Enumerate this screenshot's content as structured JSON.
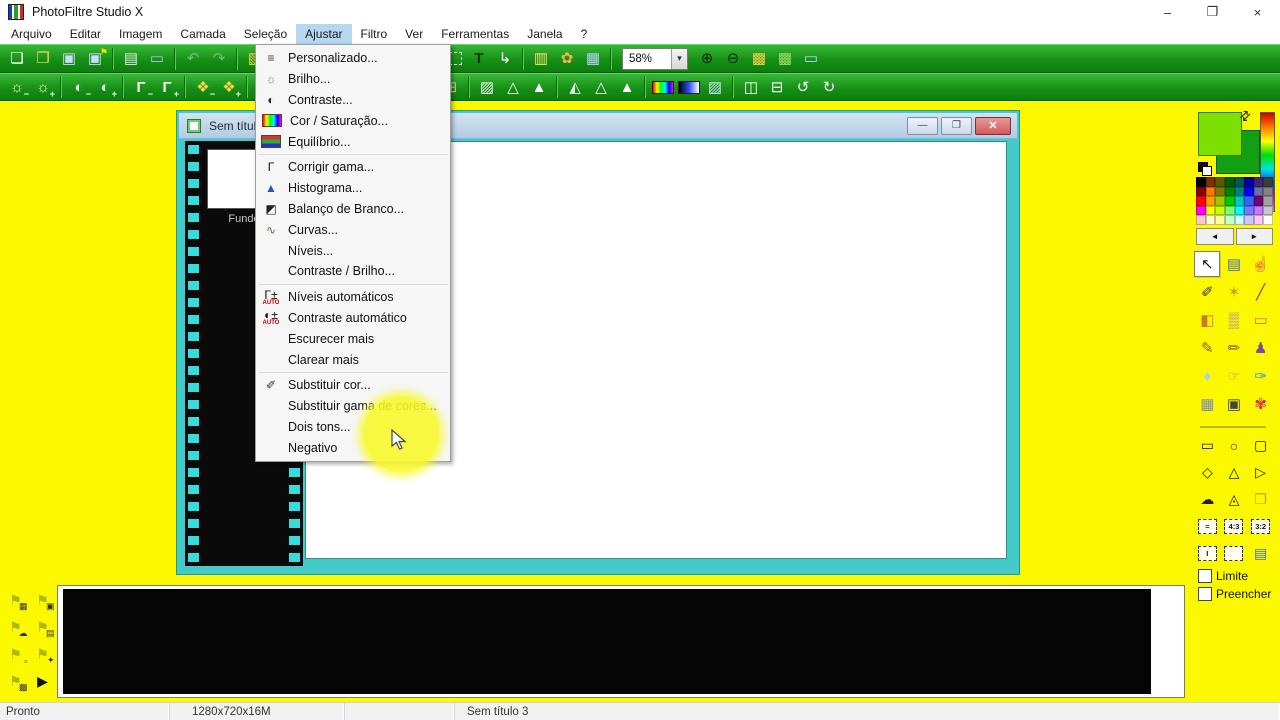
{
  "window": {
    "title": "PhotoFiltre Studio X",
    "controls": [
      {
        "id": "minimize",
        "glyph": "–"
      },
      {
        "id": "restore",
        "glyph": "❐"
      },
      {
        "id": "close",
        "glyph": "×"
      }
    ]
  },
  "menubar": {
    "items": [
      {
        "id": "arquivo",
        "label": "Arquivo"
      },
      {
        "id": "editar",
        "label": "Editar"
      },
      {
        "id": "imagem",
        "label": "Imagem"
      },
      {
        "id": "camada",
        "label": "Camada"
      },
      {
        "id": "selecao",
        "label": "Seleção"
      },
      {
        "id": "ajustar",
        "label": "Ajustar",
        "active": true
      },
      {
        "id": "filtro",
        "label": "Filtro"
      },
      {
        "id": "ver",
        "label": "Ver"
      },
      {
        "id": "ferramentas",
        "label": "Ferramentas"
      },
      {
        "id": "janela",
        "label": "Janela"
      },
      {
        "id": "ajuda",
        "label": "?"
      }
    ]
  },
  "toolbar_top": {
    "zoom_value": "58%",
    "left": [
      {
        "name": "new-file",
        "glyph": "❏",
        "color": "#ffffff"
      },
      {
        "name": "open-folder",
        "glyph": "❒",
        "color": "#f7d84a"
      },
      {
        "name": "save",
        "glyph": "▣",
        "color": "#cfd8ff"
      },
      {
        "name": "save-as",
        "glyph": "▣",
        "color": "#cfd8ff",
        "badge": "⚑",
        "badge_color": "#ffe000"
      },
      {
        "sep": true
      },
      {
        "name": "print",
        "glyph": "▤",
        "color": "#e8e8e8"
      },
      {
        "name": "scan",
        "glyph": "▭",
        "color": "#9fc4ff"
      },
      {
        "sep": true
      },
      {
        "name": "undo",
        "glyph": "↶",
        "color": "#d8f0d8",
        "grayed": true
      },
      {
        "name": "redo",
        "glyph": "↷",
        "color": "#d8f0d8",
        "grayed": true
      },
      {
        "sep": true
      },
      {
        "name": "adjust-image",
        "glyph": "▧",
        "color": "#ffd24a"
      }
    ],
    "right": [
      {
        "name": "selection-mode",
        "type": "dashed-box"
      },
      {
        "name": "text-tool",
        "glyph": "T",
        "color": "#0d330d",
        "bold": true
      },
      {
        "name": "transform",
        "glyph": "↳",
        "color": "#ffffff"
      },
      {
        "sep": true
      },
      {
        "name": "image-explorer",
        "glyph": "▥",
        "color": "#ffe36a"
      },
      {
        "name": "photomasque",
        "glyph": "✿",
        "color": "#ffb347"
      },
      {
        "name": "automate",
        "glyph": "▦",
        "color": "#bcd4ff"
      },
      {
        "sep": true
      },
      {
        "type": "zoom-combo"
      },
      {
        "name": "zoom-in",
        "glyph": "⊕",
        "color": "#0d2a0d"
      },
      {
        "name": "zoom-out",
        "glyph": "⊖",
        "color": "#0d2a0d"
      },
      {
        "name": "zoom-fit",
        "glyph": "▩",
        "color": "#ffd24a"
      },
      {
        "name": "zoom-full",
        "glyph": "▩",
        "color": "#9fe06a"
      },
      {
        "name": "full-screen",
        "glyph": "▭",
        "color": "#bcd4ff"
      }
    ]
  },
  "toolbar_filters": {
    "left": [
      {
        "name": "brightness-minus",
        "glyph": "☼",
        "sub": "−",
        "color": "#fff4b0"
      },
      {
        "name": "brightness-plus",
        "glyph": "☼",
        "sub": "+",
        "color": "#fff4b0"
      },
      {
        "sep": true
      },
      {
        "name": "contrast-minus",
        "glyph": "◐",
        "sub": "−",
        "color": "#f0f0f0"
      },
      {
        "name": "contrast-plus",
        "glyph": "◐",
        "sub": "+",
        "color": "#f0f0f0"
      },
      {
        "sep": true
      },
      {
        "name": "gamma-minus",
        "glyph": "Γ",
        "sub": "−",
        "color": "#ffffff",
        "bold": true
      },
      {
        "name": "gamma-plus",
        "glyph": "Γ",
        "sub": "+",
        "color": "#ffffff",
        "bold": true
      },
      {
        "sep": true
      },
      {
        "name": "saturation-minus",
        "glyph": "❖",
        "sub": "−",
        "color": "#ffd24a"
      },
      {
        "name": "saturation-plus",
        "glyph": "❖",
        "sub": "+",
        "color": "#ffd24a"
      },
      {
        "sep": true
      },
      {
        "name": "histogram",
        "glyph": "▄",
        "color": "#4a6aff"
      }
    ],
    "right": [
      {
        "name": "mosaic",
        "glyph": "⊞",
        "color": "#e0c090"
      },
      {
        "sep": true
      },
      {
        "name": "halftone",
        "glyph": "▨",
        "color": "#f0f0f0"
      },
      {
        "name": "soften",
        "glyph": "△",
        "color": "#ffffff"
      },
      {
        "name": "sharpen",
        "glyph": "▲",
        "color": "#ffffff"
      },
      {
        "sep": true
      },
      {
        "name": "emboss",
        "glyph": "◭",
        "color": "#e8e8e8"
      },
      {
        "name": "relief-minus",
        "glyph": "△",
        "color": "#ffffff"
      },
      {
        "name": "relief-plus",
        "glyph": "▲",
        "color": "#ffffff"
      },
      {
        "sep": true
      },
      {
        "name": "gradient-rainbow",
        "type": "rainbow-bar"
      },
      {
        "name": "gradient-blue",
        "type": "blue-bar"
      },
      {
        "name": "antialias",
        "glyph": "▨",
        "color": "#cfe4ff"
      },
      {
        "sep": true
      },
      {
        "name": "flip-horizontal",
        "glyph": "◫",
        "color": "#ffffff"
      },
      {
        "name": "flip-vertical",
        "glyph": "⊟",
        "color": "#ffffff"
      },
      {
        "name": "rotate-left",
        "glyph": "↺",
        "color": "#ffffff"
      },
      {
        "name": "rotate-right",
        "glyph": "↻",
        "color": "#ffffff"
      }
    ]
  },
  "adjust_menu": {
    "items": [
      {
        "id": "personalizado",
        "label": "Personalizado...",
        "icon": "sliders-icon",
        "glyph": "≡",
        "color": "#444444"
      },
      {
        "id": "brilho",
        "label": "Brilho...",
        "icon": "brightness-icon",
        "glyph": "☼",
        "color": "#777777"
      },
      {
        "id": "contraste",
        "label": "Contraste...",
        "icon": "contrast-icon",
        "glyph": "◐",
        "color": "#222222"
      },
      {
        "id": "cor-saturacao",
        "label": "Cor / Saturação...",
        "icon": "saturation-icon",
        "type": "rainbow"
      },
      {
        "id": "equilibrio",
        "label": "Equilíbrio...",
        "icon": "color-balance-icon",
        "type": "balance"
      },
      {
        "separator": true
      },
      {
        "id": "corrigir-gama",
        "label": "Corrigir gama...",
        "icon": "gamma-icon",
        "glyph": "Γ",
        "color": "#111111"
      },
      {
        "id": "histograma",
        "label": "Histograma...",
        "icon": "histogram-icon",
        "glyph": "▲",
        "color": "#2a52c8"
      },
      {
        "id": "balanco-de-branco",
        "label": "Balanço de Branco...",
        "icon": "white-balance-icon",
        "glyph": "◩",
        "color": "#222222"
      },
      {
        "id": "curvas",
        "label": "Curvas...",
        "icon": "curves-icon",
        "glyph": "∿",
        "color": "#3a7a3a"
      },
      {
        "id": "niveis",
        "label": "Níveis..."
      },
      {
        "id": "contraste-brilho",
        "label": "Contraste / Brilho..."
      },
      {
        "separator": true
      },
      {
        "id": "niveis-automaticos",
        "label": "Níveis automáticos",
        "icon": "auto-levels-icon",
        "glyph": "Γ±",
        "auto": "AUTO",
        "color": "#111111"
      },
      {
        "id": "contraste-automatico",
        "label": "Contraste automático",
        "icon": "auto-contrast-icon",
        "glyph": "◐±",
        "auto": "AUTO",
        "color": "#111111"
      },
      {
        "id": "escurecer-mais",
        "label": "Escurecer mais"
      },
      {
        "id": "clarear-mais",
        "label": "Clarear mais"
      },
      {
        "separator": true
      },
      {
        "id": "substituir-cor",
        "label": "Substituir cor...",
        "icon": "eyedropper-icon",
        "glyph": "✐",
        "color": "#333333"
      },
      {
        "id": "substituir-gama-de-cores",
        "label": "Substituir gama de cores..."
      },
      {
        "id": "dois-tons",
        "label": "Dois tons..."
      },
      {
        "id": "negativo",
        "label": "Negativo"
      }
    ]
  },
  "document_window": {
    "title": "Sem título",
    "layer_label": "Fundo",
    "controls": [
      {
        "id": "minimize",
        "glyph": "—"
      },
      {
        "id": "maximize",
        "glyph": "❐"
      },
      {
        "id": "close",
        "glyph": "✕"
      }
    ]
  },
  "sidebar": {
    "foreground_color": "#7ce000",
    "background_color": "#12a012",
    "swap_glyph": "⇄",
    "arrow_left": "◄",
    "arrow_right": "►",
    "palette": [
      "#000000",
      "#7a3000",
      "#5a5a00",
      "#005a00",
      "#005a5a",
      "#0000a0",
      "#3c2878",
      "#3c3c3c",
      "#8c0000",
      "#ff7800",
      "#7a7a00",
      "#008200",
      "#008282",
      "#0000ff",
      "#6e6ea0",
      "#828282",
      "#ff0000",
      "#ffa000",
      "#a0c800",
      "#00c800",
      "#00c8c8",
      "#3264ff",
      "#780078",
      "#a0a0a0",
      "#ff00ff",
      "#ffff00",
      "#c8ff00",
      "#78ff78",
      "#00ffff",
      "#7878ff",
      "#c878ff",
      "#c8c8c8",
      "#ffc8c8",
      "#ffffc8",
      "#ffffa0",
      "#c8ffc8",
      "#c8ffff",
      "#c8c8ff",
      "#ffc8ff",
      "#ffffff"
    ],
    "tools": [
      {
        "name": "arrow-tool",
        "glyph": "↖",
        "color": "#111111",
        "selected": true
      },
      {
        "name": "layer-manager-tool",
        "glyph": "▤",
        "color": "#4a6ac8"
      },
      {
        "name": "move-hand-tool",
        "glyph": "☝",
        "color": "#c89a5a"
      },
      {
        "name": "eyedropper-tool",
        "glyph": "✐",
        "color": "#333333"
      },
      {
        "name": "magic-wand-tool",
        "glyph": "✶",
        "color": "#c8a020"
      },
      {
        "name": "line-tool",
        "glyph": "╱",
        "color": "#b03030"
      },
      {
        "name": "fill-tool",
        "glyph": "◧",
        "color": "#c87830"
      },
      {
        "name": "airbrush-tool",
        "glyph": "▒",
        "color": "#9a6ac8"
      },
      {
        "name": "eraser-tool",
        "glyph": "▭",
        "color": "#c87860"
      },
      {
        "name": "paintbrush-tool",
        "glyph": "✎",
        "color": "#8a5a2a"
      },
      {
        "name": "advanced-brush-tool",
        "glyph": "✏",
        "color": "#8a5a2a"
      },
      {
        "name": "clone-stamp-tool",
        "glyph": "♟",
        "color": "#7a4aa0"
      },
      {
        "name": "blur-tool",
        "glyph": "♦",
        "color": "#a9cff0"
      },
      {
        "name": "smudge-tool",
        "glyph": "☞",
        "color": "#c89a5a"
      },
      {
        "name": "retouch-tool",
        "glyph": "✑",
        "color": "#4a90d0"
      },
      {
        "name": "pattern-tool",
        "glyph": "▦",
        "color": "#7a8ac0"
      },
      {
        "name": "photo-brush-tool",
        "glyph": "▣",
        "color": "#444444"
      },
      {
        "name": "nozzle-tool",
        "glyph": "✾",
        "color": "#d03040"
      }
    ],
    "shapes": [
      {
        "name": "rectangle-select",
        "glyph": "▭"
      },
      {
        "name": "ellipse-select",
        "glyph": "○"
      },
      {
        "name": "rounded-rect-select",
        "glyph": "▢"
      },
      {
        "name": "rhombus-select",
        "glyph": "◇"
      },
      {
        "name": "triangle-select",
        "glyph": "△"
      },
      {
        "name": "right-triangle-select",
        "glyph": "▷"
      },
      {
        "name": "lasso-select",
        "glyph": "☁"
      },
      {
        "name": "polygon-select",
        "glyph": "◬"
      },
      {
        "name": "load-selection",
        "glyph": "❒",
        "color": "#caa32a"
      },
      {
        "name": "ratio-1-1",
        "text": "="
      },
      {
        "name": "ratio-4-3",
        "text": "4:3"
      },
      {
        "name": "ratio-3-2",
        "text": "3:2"
      },
      {
        "name": "ratio-i",
        "text": "I"
      },
      {
        "name": "manual-selection",
        "text": ""
      },
      {
        "name": "selection-options",
        "glyph": "▤",
        "color": "#4a6ac8"
      }
    ],
    "checkboxes": [
      {
        "id": "limite",
        "label": "Limite",
        "checked": false
      },
      {
        "id": "preencher",
        "label": "Preencher",
        "checked": false
      }
    ]
  },
  "bottom_panel": {
    "flag_buttons": [
      {
        "name": "flag-image",
        "glyph": "⚑",
        "sub": "▦"
      },
      {
        "name": "flag-layer",
        "glyph": "⚑",
        "sub": "▣"
      },
      {
        "name": "flag-lasso",
        "glyph": "⚑",
        "sub": "☁"
      },
      {
        "name": "flag-save",
        "glyph": "⚑",
        "sub": "▤"
      },
      {
        "name": "flag-select",
        "glyph": "⚑",
        "sub": "▫"
      },
      {
        "name": "flag-effect",
        "glyph": "⚑",
        "sub": "✦"
      },
      {
        "name": "flag-grid",
        "glyph": "⚑",
        "sub": "▩"
      },
      {
        "name": "play",
        "glyph": "▶",
        "color": "#111111"
      }
    ]
  },
  "statusbar": {
    "status": "Pronto",
    "dimensions": "1280x720x16M",
    "document": "Sem título 3"
  },
  "annotation": {
    "highlight_color": "#f8f828"
  }
}
